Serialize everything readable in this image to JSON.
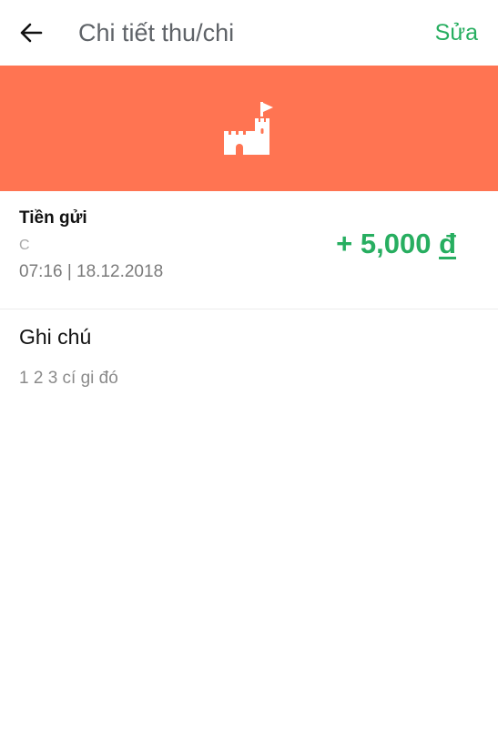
{
  "header": {
    "title": "Chi tiết thu/chi",
    "edit_label": "Sửa",
    "back_icon": "arrow-left-icon"
  },
  "banner": {
    "icon": "castle-icon",
    "color": "#ff7452"
  },
  "transaction": {
    "category": "Tiền gửi",
    "wallet": "C",
    "datetime": "07:16 | 18.12.2018",
    "amount_prefix": "+ 5,000",
    "currency_symbol": "đ"
  },
  "note": {
    "title": "Ghi chú",
    "text": "1 2 3 cí gi đó"
  },
  "colors": {
    "accent": "#27ae60",
    "banner": "#ff7452"
  }
}
